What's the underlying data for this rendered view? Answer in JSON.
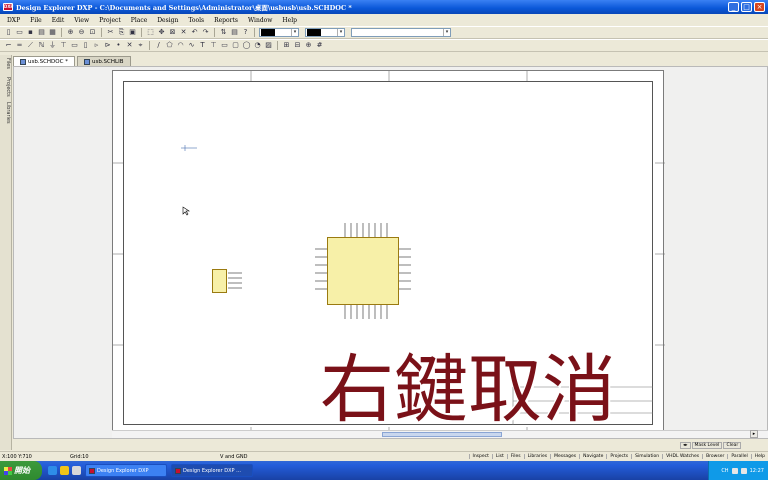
{
  "window": {
    "title": "Design Explorer DXP - C:\\Documents and Settings\\Administrator\\桌面\\usbusb\\usb.SCHDOC *",
    "app_icon_text": "DXP",
    "buttons": [
      "_",
      "□",
      "×"
    ]
  },
  "menu": [
    "DXP",
    "File",
    "Edit",
    "View",
    "Project",
    "Place",
    "Design",
    "Tools",
    "Reports",
    "Window",
    "Help"
  ],
  "toolbar": {
    "fill_color": "#000000",
    "border_color": "#000000"
  },
  "left_panel_tabs": [
    "Files",
    "Projects",
    "Libraries"
  ],
  "doc_tabs": [
    {
      "label": "usb.SCHDOC *",
      "active": true
    },
    {
      "label": "usb.SCHLIB",
      "active": false
    }
  ],
  "caption": "右鍵取消",
  "status": {
    "coords": "X:100 Y:710",
    "grid": "Grid:10",
    "net": "V and GND",
    "panel_tabs": [
      "Inspect",
      "List",
      "Files",
      "Libraries",
      "Messages",
      "Navigate",
      "Projects",
      "Simulation",
      "VHDL Watches",
      "Browser",
      "Parallel",
      "Help"
    ]
  },
  "panel_controls": [
    "Mask Level",
    "Clear"
  ],
  "taskbar": {
    "start_label": "開始",
    "tasks": [
      {
        "label": "Design Explorer DXP",
        "active": false
      },
      {
        "label": "Design Explorer DXP ...",
        "active": true
      }
    ],
    "tray_text": "CH",
    "clock": "12:27"
  },
  "colors": {
    "caption": "#7a1118",
    "chip_fill": "#f7f0a8",
    "title_bar": "#0a57d8"
  }
}
